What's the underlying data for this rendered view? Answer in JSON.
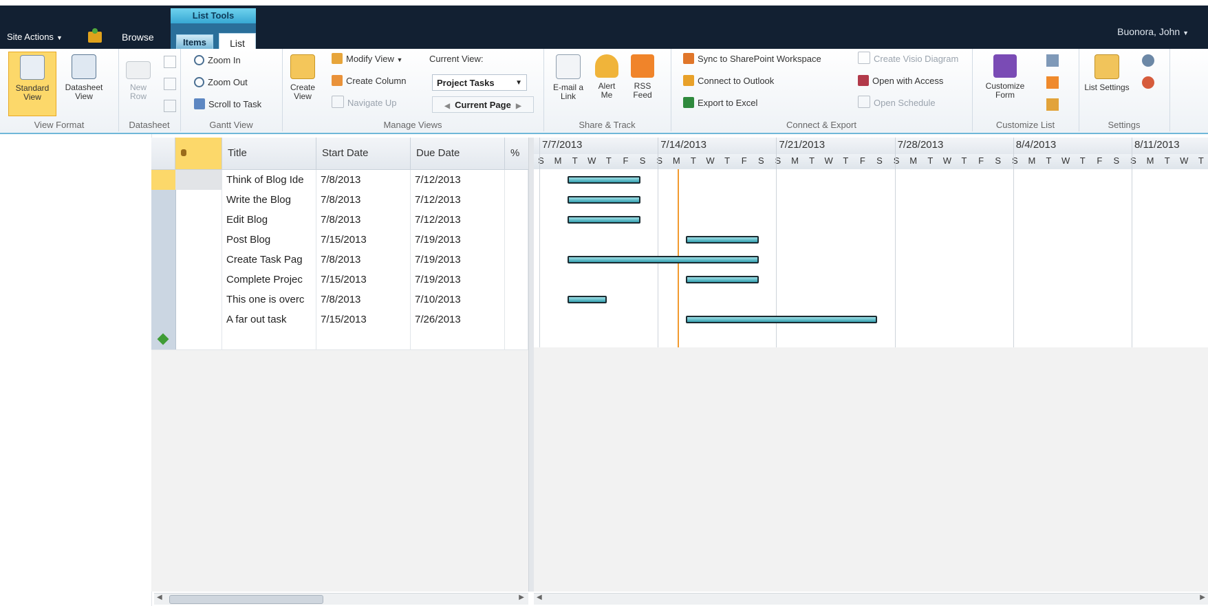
{
  "top": {
    "site_actions": "Site Actions",
    "tab_browse": "Browse",
    "context_group": "List Tools",
    "tab_items": "Items",
    "tab_list": "List",
    "user": "Buonora, John"
  },
  "ribbon": {
    "view_format": {
      "label": "View Format",
      "standard": "Standard View",
      "datasheet": "Datasheet View"
    },
    "datasheet": {
      "label": "Datasheet",
      "new_row": "New Row"
    },
    "gantt": {
      "label": "Gantt View",
      "zoom_in": "Zoom In",
      "zoom_out": "Zoom Out",
      "scroll_to_task": "Scroll to Task"
    },
    "manage": {
      "label": "Manage Views",
      "create_view": "Create View",
      "modify_view": "Modify View",
      "create_column": "Create Column",
      "navigate_up": "Navigate Up",
      "current_view_label": "Current View:",
      "current_view_value": "Project Tasks",
      "current_page": "Current Page"
    },
    "share": {
      "label": "Share & Track",
      "email": "E-mail a Link",
      "alert": "Alert Me",
      "rss": "RSS Feed"
    },
    "connect": {
      "label": "Connect & Export",
      "sync": "Sync to SharePoint Workspace",
      "outlook": "Connect to Outlook",
      "excel": "Export to Excel",
      "visio": "Create Visio Diagram",
      "access": "Open with Access",
      "schedule": "Open Schedule"
    },
    "customize": {
      "label": "Customize List",
      "form": "Customize Form"
    },
    "settings": {
      "label": "Settings",
      "list_settings": "List Settings"
    }
  },
  "grid": {
    "columns": [
      "",
      "Title",
      "Start Date",
      "Due Date",
      "% "
    ],
    "rows": [
      {
        "title": "Think of Blog Ide",
        "start": "7/8/2013",
        "due": "7/12/2013"
      },
      {
        "title": "Write the Blog",
        "start": "7/8/2013",
        "due": "7/12/2013"
      },
      {
        "title": "Edit Blog",
        "start": "7/8/2013",
        "due": "7/12/2013"
      },
      {
        "title": "Post Blog",
        "start": "7/15/2013",
        "due": "7/19/2013"
      },
      {
        "title": "Create Task Pag",
        "start": "7/8/2013",
        "due": "7/19/2013"
      },
      {
        "title": "Complete Projec",
        "start": "7/15/2013",
        "due": "7/19/2013"
      },
      {
        "title": "This one is overc",
        "start": "7/8/2013",
        "due": "7/10/2013"
      },
      {
        "title": "A far out task",
        "start": "7/15/2013",
        "due": "7/26/2013"
      }
    ]
  },
  "gantt": {
    "weeks": [
      "7/7/2013",
      "7/14/2013",
      "7/21/2013",
      "7/28/2013",
      "8/4/2013",
      "8/11/2013"
    ],
    "days": [
      "S",
      "M",
      "T",
      "W",
      "T",
      "F",
      "S"
    ],
    "timeline_start": "2013-07-07",
    "today": "2013-07-15"
  },
  "colors": {
    "topbar": "#122032",
    "accent": "#6fb7d9",
    "bar": "#35a0b0",
    "today": "#f29a2e",
    "selected": "#fcd86a"
  }
}
